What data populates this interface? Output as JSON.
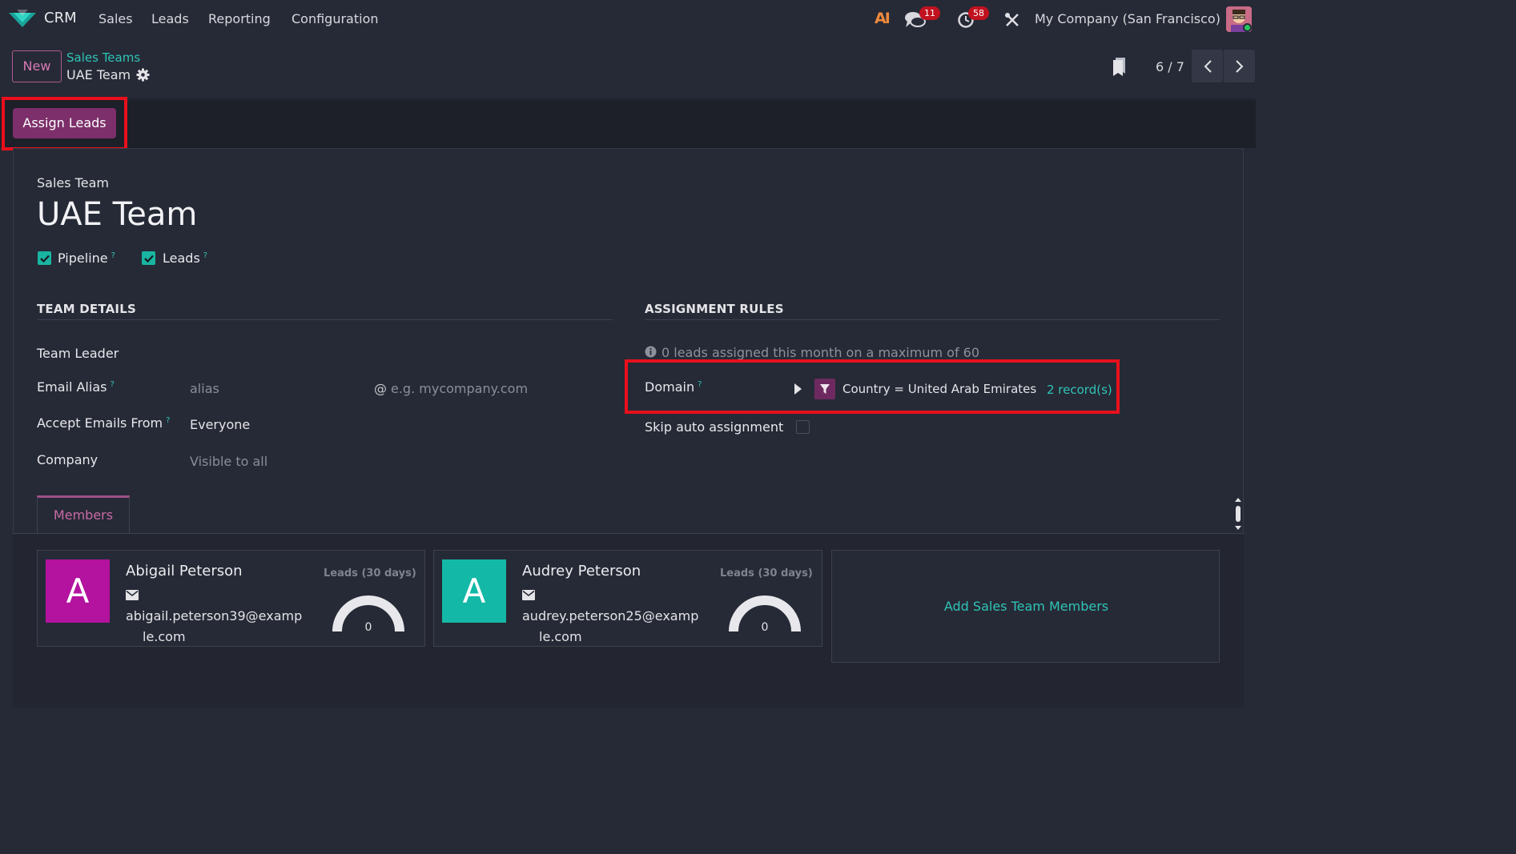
{
  "navbar": {
    "app_name": "CRM",
    "menu": [
      "Sales",
      "Leads",
      "Reporting",
      "Configuration"
    ],
    "discuss_count": "11",
    "activity_count": "58",
    "company": "My Company (San Francisco)",
    "ai_label": "AI"
  },
  "control": {
    "new_label": "New",
    "breadcrumb_parent": "Sales Teams",
    "breadcrumb_current": "UAE Team",
    "pager": "6 / 7"
  },
  "actions": {
    "assign_leads": "Assign Leads"
  },
  "form": {
    "subtitle": "Sales Team",
    "name": "UAE Team",
    "pipeline_label": "Pipeline",
    "leads_label": "Leads",
    "help_mark": "?",
    "team_details": {
      "header": "TEAM DETAILS",
      "team_leader_label": "Team Leader",
      "email_alias_label": "Email Alias",
      "alias_placeholder": "alias",
      "domain_at": "@",
      "domain_placeholder": "e.g. mycompany.com",
      "accept_emails_label": "Accept Emails From",
      "accept_emails_value": "Everyone",
      "company_label": "Company",
      "company_placeholder": "Visible to all"
    },
    "assignment_rules": {
      "header": "ASSIGNMENT RULES",
      "info": "0 leads assigned this month on a maximum of 60",
      "domain_label": "Domain",
      "domain_text": "Country = United Arab Emirates",
      "records": "2 record(s)",
      "skip_label": "Skip auto assignment"
    }
  },
  "members_tab": {
    "tab_label": "Members",
    "members": [
      {
        "initial": "A",
        "name": "Abigail Peterson",
        "email_line1": "abigail.peterson39@examp",
        "email_line2": "le.com",
        "leads_label": "Leads (30 days)",
        "leads_value": "0",
        "color": "#b3139f"
      },
      {
        "initial": "A",
        "name": "Audrey Peterson",
        "email_line1": "audrey.peterson25@examp",
        "email_line2": "le.com",
        "leads_label": "Leads (30 days)",
        "leads_value": "0",
        "color": "#14b8a6"
      }
    ],
    "add_label": "Add Sales Team Members"
  }
}
